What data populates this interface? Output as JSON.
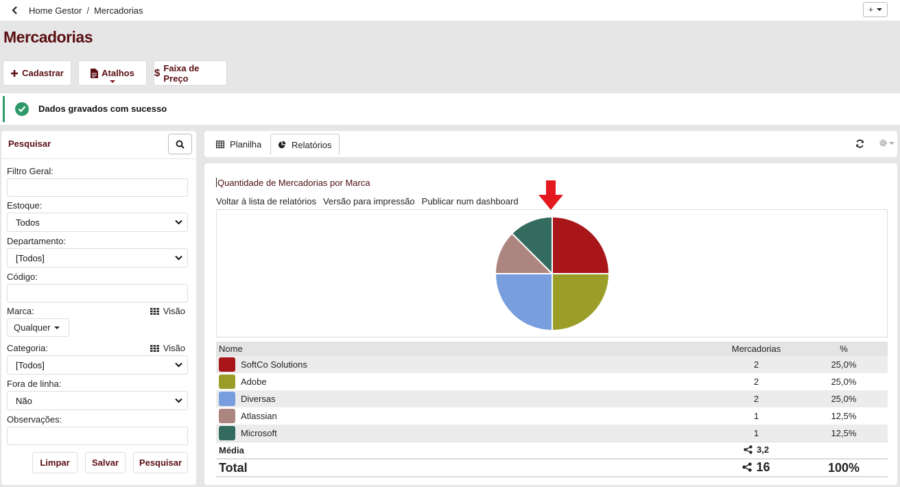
{
  "breadcrumb": {
    "home": "Home Gestor",
    "current": "Mercadorias"
  },
  "topbar": {
    "plus": "+"
  },
  "page_title": "Mercadorias",
  "actions": {
    "cadastrar": "Cadastrar",
    "atalhos": "Atalhos",
    "faixa": "Faixa de Preço"
  },
  "success_message": "Dados gravados com sucesso",
  "search_panel": {
    "title": "Pesquisar",
    "filtro_geral": "Filtro Geral:",
    "estoque_label": "Estoque:",
    "estoque_value": "Todos",
    "departamento_label": "Departamento:",
    "departamento_value": "[Todos]",
    "codigo_label": "Código:",
    "marca_label": "Marca:",
    "marca_value": "Qualquer",
    "visao": "Visão",
    "categoria_label": "Categoria:",
    "categoria_value": "[Todos]",
    "fora_linha_label": "Fora de linha:",
    "fora_linha_value": "Não",
    "observacoes_label": "Observações:",
    "btn_limpar": "Limpar",
    "btn_salvar": "Salvar",
    "btn_pesquisar": "Pesquisar"
  },
  "tabs": {
    "planilha": "Planilha",
    "relatorios": "Relatórios"
  },
  "report": {
    "title": "Quantidade de Mercadorias por Marca",
    "links": {
      "voltar": "Voltar à lista de relatórios",
      "impressao": "Versão para impressão",
      "publicar": "Publicar num dashboard"
    }
  },
  "colors": {
    "brand": "#5a0e12",
    "success": "#2e9a6a",
    "softco": "#a8161a",
    "adobe": "#9a9e28",
    "diversas": "#789ede",
    "atlassian": "#ac8580",
    "microsoft": "#336b5f",
    "arrow": "#e3191f"
  },
  "table": {
    "headers": {
      "nome": "Nome",
      "mercadorias": "Mercadorias",
      "pct": "%"
    },
    "rows": [
      {
        "nome": "SoftCo Solutions",
        "mercadorias": "2",
        "pct": "25,0%",
        "color": "#a8161a"
      },
      {
        "nome": "Adobe",
        "mercadorias": "2",
        "pct": "25,0%",
        "color": "#9a9e28"
      },
      {
        "nome": "Diversas",
        "mercadorias": "2",
        "pct": "25,0%",
        "color": "#789ede"
      },
      {
        "nome": "Atlassian",
        "mercadorias": "1",
        "pct": "12,5%",
        "color": "#ac8580"
      },
      {
        "nome": "Microsoft",
        "mercadorias": "1",
        "pct": "12,5%",
        "color": "#336b5f"
      }
    ],
    "media_label": "Média",
    "media_value": "3,2",
    "total_label": "Total",
    "total_value": "16",
    "total_pct": "100%"
  },
  "chart_data": {
    "type": "pie",
    "categories": [
      "SoftCo Solutions",
      "Adobe",
      "Diversas",
      "Atlassian",
      "Microsoft"
    ],
    "values": [
      2,
      2,
      2,
      1,
      1
    ],
    "colors": [
      "#a8161a",
      "#9a9e28",
      "#789ede",
      "#ac8580",
      "#336b5f"
    ]
  }
}
